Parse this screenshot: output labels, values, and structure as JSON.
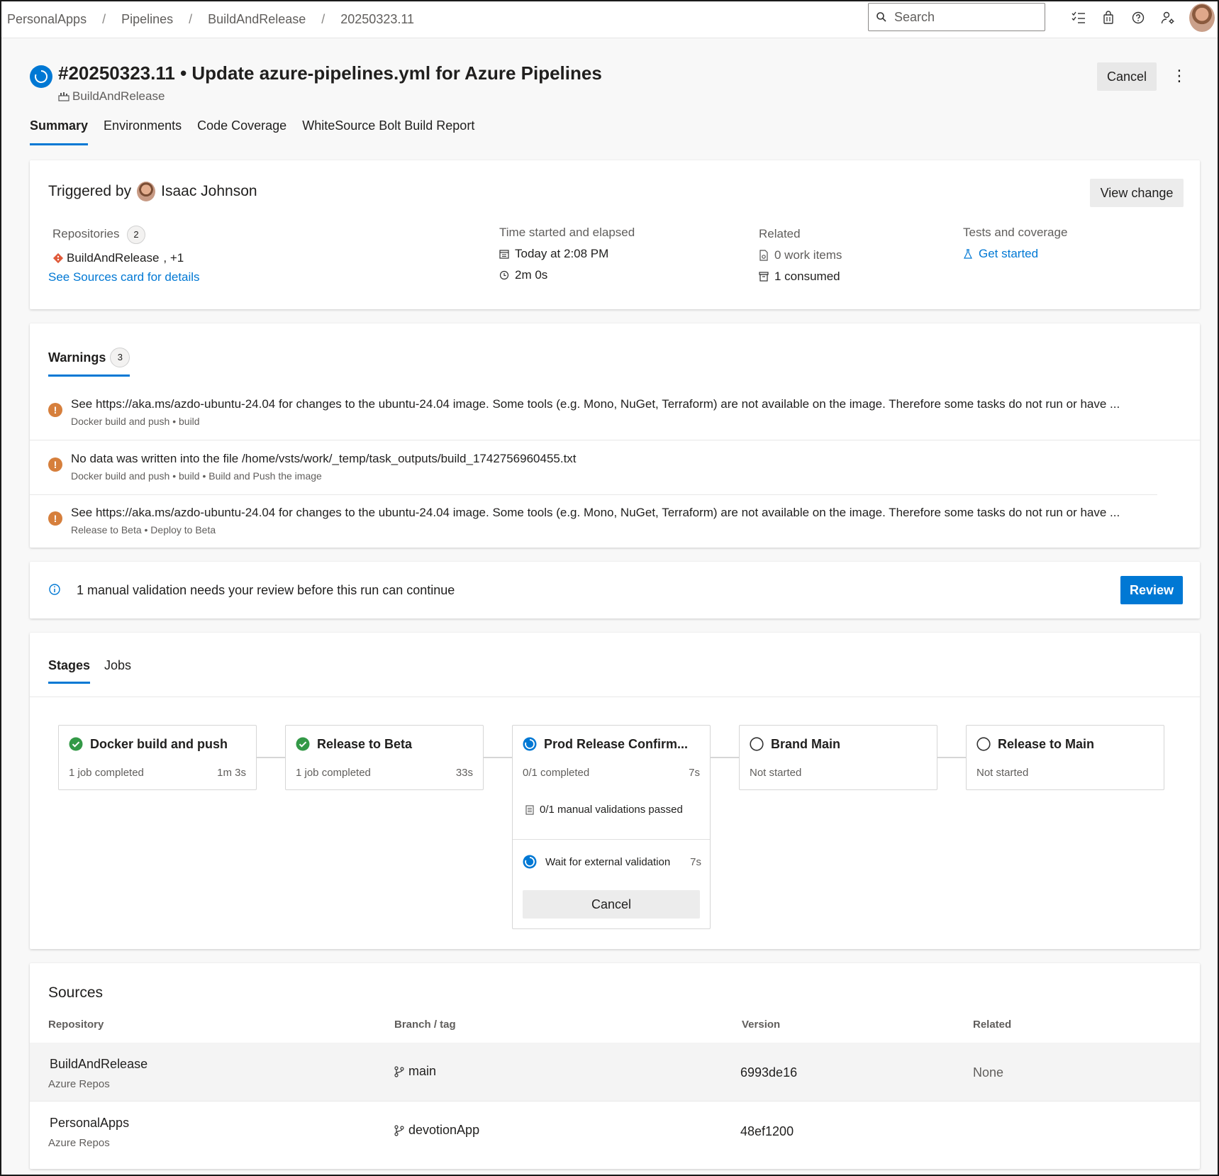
{
  "breadcrumb": [
    "PersonalApps",
    "Pipelines",
    "BuildAndRelease",
    "20250323.11"
  ],
  "search": {
    "placeholder": "Search"
  },
  "top_icons": [
    "task-list-icon",
    "shopping-bag-icon",
    "help-icon",
    "user-settings-icon"
  ],
  "run": {
    "title": "#20250323.11 • Update azure-pipelines.yml for Azure Pipelines",
    "pipeline": "BuildAndRelease",
    "cancel_label": "Cancel",
    "more_label": "⋮"
  },
  "tabs": [
    "Summary",
    "Environments",
    "Code Coverage",
    "WhiteSource Bolt Build Report"
  ],
  "summary": {
    "triggered_by_label": "Triggered by",
    "user": "Isaac Johnson",
    "view_change_label": "View change",
    "repositories_label": "Repositories",
    "repositories_count": "2",
    "repo_name": "BuildAndRelease",
    "repo_extra": ", +1",
    "see_sources": "See Sources card for details",
    "time_label": "Time started and elapsed",
    "started": "Today at 2:08 PM",
    "elapsed": "2m 0s",
    "related_label": "Related",
    "work_items": "0 work items",
    "consumed": "1 consumed",
    "tests_label": "Tests and coverage",
    "get_started": "Get started"
  },
  "warnings": {
    "label": "Warnings",
    "count": "3",
    "items": [
      {
        "message": "See https://aka.ms/azdo-ubuntu-24.04 for changes to the ubuntu-24.04 image. Some tools (e.g. Mono, NuGet, Terraform) are not available on the image. Therefore some tasks do not run or have ...",
        "source": "Docker build and push • build"
      },
      {
        "message": "No data was written into the file /home/vsts/work/_temp/task_outputs/build_1742756960455.txt",
        "source": "Docker build and push • build • Build and Push the image"
      },
      {
        "message": "See https://aka.ms/azdo-ubuntu-24.04 for changes to the ubuntu-24.04 image. Some tools (e.g. Mono, NuGet, Terraform) are not available on the image. Therefore some tasks do not run or have ...",
        "source": "Release to Beta • Deploy to Beta"
      }
    ]
  },
  "manual": {
    "text": "1 manual validation needs your review before this run can continue",
    "review_label": "Review"
  },
  "stages_tabs": [
    "Stages",
    "Jobs"
  ],
  "stages": [
    {
      "name": "Docker build and push",
      "status": "1 job completed",
      "duration": "1m 3s",
      "state": "succeeded"
    },
    {
      "name": "Release to Beta",
      "status": "1 job completed",
      "duration": "33s",
      "state": "succeeded"
    },
    {
      "name": "Prod Release Confirm...",
      "status": "0/1 completed",
      "duration": "7s",
      "state": "running",
      "validations": "0/1 manual validations passed",
      "job_name": "Wait for external validation",
      "job_duration": "7s",
      "cancel_label": "Cancel"
    },
    {
      "name": "Brand Main",
      "status": "Not started",
      "duration": "",
      "state": "not-started"
    },
    {
      "name": "Release to Main",
      "status": "Not started",
      "duration": "",
      "state": "not-started"
    }
  ],
  "sources": {
    "title": "Sources",
    "headers": [
      "Repository",
      "Branch / tag",
      "Version",
      "Related"
    ],
    "rows": [
      {
        "repo": "BuildAndRelease",
        "provider": "Azure Repos",
        "branch": "main",
        "version": "6993de16",
        "related": "None"
      },
      {
        "repo": "PersonalApps",
        "provider": "Azure Repos",
        "branch": "devotionApp",
        "version": "48ef1200",
        "related": ""
      }
    ]
  },
  "colors": {
    "accent": "#0078d4",
    "success": "#339947",
    "warning": "#d67f3c"
  }
}
